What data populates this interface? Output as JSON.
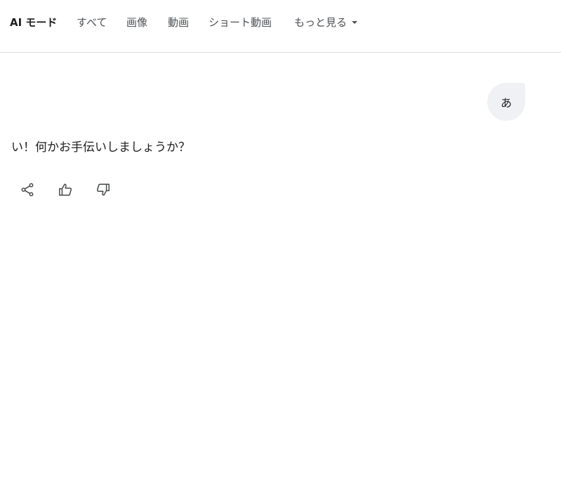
{
  "nav": {
    "tabs": [
      {
        "label": "AI モード",
        "active": true
      },
      {
        "label": "すべて"
      },
      {
        "label": "画像"
      },
      {
        "label": "動画"
      },
      {
        "label": "ショート動画"
      },
      {
        "label": "もっと見る",
        "has_dropdown": true
      }
    ]
  },
  "conversation": {
    "user_message": "あ",
    "ai_reply": "い！何かお手伝いしましょうか？"
  },
  "actions": {
    "icons": [
      "share-icon",
      "thumbs-up-icon",
      "thumbs-down-icon"
    ]
  },
  "colors": {
    "bubble_bg": "#f0f1f5",
    "nav_text": "#4d5156",
    "divider": "#dadce0"
  }
}
